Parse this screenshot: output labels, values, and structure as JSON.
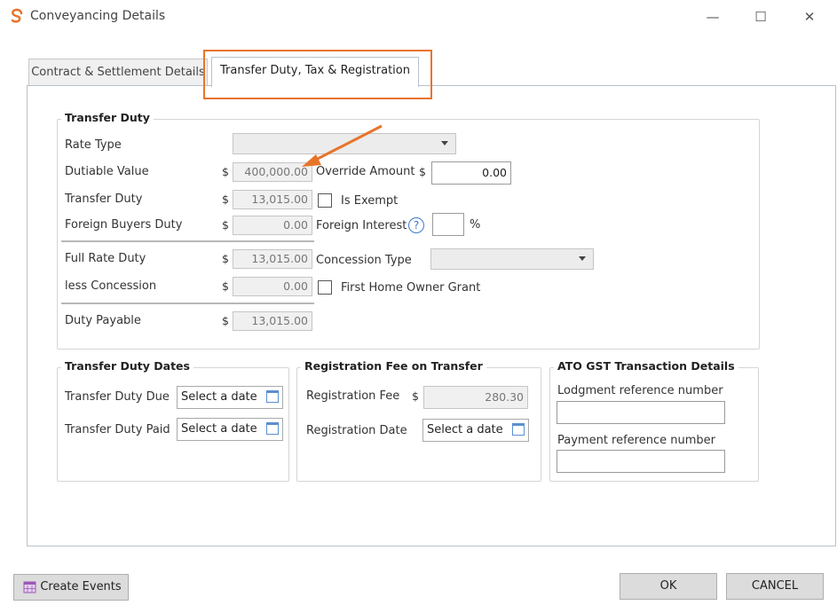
{
  "window": {
    "title": "Conveyancing Details"
  },
  "tabs": [
    {
      "label": "Contract & Settlement Details"
    },
    {
      "label": "Transfer Duty, Tax & Registration"
    }
  ],
  "transfer_duty": {
    "legend": "Transfer Duty",
    "rate_type_label": "Rate Type",
    "rate_type_value": "",
    "dutiable_value_label": "Dutiable Value",
    "dutiable_value": "400,000.00",
    "transfer_duty_label": "Transfer Duty",
    "transfer_duty_value": "13,015.00",
    "foreign_buyers_duty_label": "Foreign Buyers Duty",
    "foreign_buyers_duty_value": "0.00",
    "full_rate_duty_label": "Full Rate Duty",
    "full_rate_duty_value": "13,015.00",
    "less_concession_label": "less Concession",
    "less_concession_value": "0.00",
    "duty_payable_label": "Duty Payable",
    "duty_payable_value": "13,015.00",
    "currency_symbol": "$",
    "override_amount_label": "Override Amount",
    "override_amount_value": "0.00",
    "is_exempt_label": "Is Exempt",
    "foreign_interest_label": "Foreign Interest",
    "foreign_interest_help": "?",
    "foreign_interest_value": "",
    "percent_symbol": "%",
    "concession_type_label": "Concession Type",
    "concession_type_value": "",
    "first_home_owner_grant_label": "First Home Owner Grant"
  },
  "transfer_duty_dates": {
    "legend": "Transfer Duty Dates",
    "due_label": "Transfer Duty Due",
    "paid_label": "Transfer Duty Paid",
    "date_placeholder": "Select a date"
  },
  "registration_fee": {
    "legend": "Registration Fee on Transfer",
    "fee_label": "Registration Fee",
    "fee_value": "280.30",
    "date_label": "Registration Date",
    "date_placeholder": "Select a date"
  },
  "ato_gst": {
    "legend": "ATO GST Transaction Details",
    "lodgment_label": "Lodgment reference number",
    "lodgment_value": "",
    "payment_label": "Payment reference number",
    "payment_value": ""
  },
  "footer": {
    "create_events_label": "Create Events",
    "ok_label": "OK",
    "cancel_label": "CANCEL"
  },
  "colors": {
    "highlight": "#e8742a",
    "accent": "#3b7bd0"
  }
}
